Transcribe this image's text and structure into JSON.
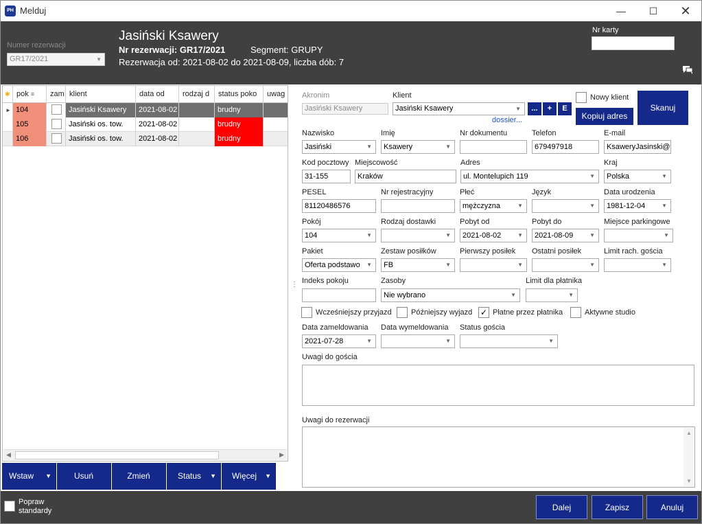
{
  "window": {
    "title": "Melduj",
    "app_icon_text": "PH"
  },
  "header": {
    "reservation_number_label": "Numer rezerwacji",
    "reservation_number_value": "GR17/2021",
    "guest_name": "Jasiński Ksawery",
    "reservation_nr": "Nr rezerwacji: GR17/2021",
    "segment": "Segment: GRUPY",
    "reservation_range": "Rezerwacja od: 2021-08-02 do 2021-08-09, liczba dób: 7",
    "card_label": "Nr karty",
    "card_value": ""
  },
  "grid": {
    "columns": [
      "pok",
      "zam",
      "klient",
      "data od",
      "rodzaj d",
      "status poko",
      "uwag"
    ],
    "rows": [
      {
        "room": "104",
        "client": "Jasiński Ksawery",
        "date_from": "2021-08-02",
        "meal": "",
        "status": "brudny",
        "notes": ""
      },
      {
        "room": "105",
        "client": "Jasiński os. tow.",
        "date_from": "2021-08-02",
        "meal": "",
        "status": "brudny",
        "notes": ""
      },
      {
        "room": "106",
        "client": "Jasiński os. tow.",
        "date_from": "2021-08-02",
        "meal": "",
        "status": "brudny",
        "notes": ""
      }
    ]
  },
  "actions": {
    "insert": "Wstaw",
    "delete": "Usuń",
    "change": "Zmień",
    "status": "Status",
    "more": "Więcej"
  },
  "form": {
    "akronim": {
      "label": "Akronim",
      "value": "Jasiński Ksawery"
    },
    "klient": {
      "label": "Klient",
      "value": "Jasiński Ksawery"
    },
    "btn_dots": "...",
    "btn_plus": "+",
    "btn_e": "E",
    "dossier": "dossier...",
    "nowy_klient": "Nowy klient",
    "kopiuj_adres": "Kopiuj adres",
    "skanuj": "Skanuj",
    "nazwisko": {
      "label": "Nazwisko",
      "value": "Jasiński"
    },
    "imie": {
      "label": "Imię",
      "value": "Ksawery"
    },
    "nr_dokumentu": {
      "label": "Nr dokumentu",
      "value": ""
    },
    "telefon": {
      "label": "Telefon",
      "value": "679497918"
    },
    "email": {
      "label": "E-mail",
      "value": "KsaweryJasinski@t"
    },
    "kod_pocztowy": {
      "label": "Kod pocztowy",
      "value": "31-155"
    },
    "miejscowosc": {
      "label": "Miejscowość",
      "value": "Kraków"
    },
    "adres": {
      "label": "Adres",
      "value": "ul. Montelupich 119"
    },
    "kraj": {
      "label": "Kraj",
      "value": "Polska"
    },
    "pesel": {
      "label": "PESEL",
      "value": "81120486576"
    },
    "nr_rejestracyjny": {
      "label": "Nr rejestracyjny",
      "value": ""
    },
    "plec": {
      "label": "Płeć",
      "value": "mężczyzna"
    },
    "jezyk": {
      "label": "Język",
      "value": ""
    },
    "data_urodzenia": {
      "label": "Data urodzenia",
      "value": "1981-12-04"
    },
    "pokoj": {
      "label": "Pokój",
      "value": "104"
    },
    "rodzaj_dostawki": {
      "label": "Rodzaj dostawki",
      "value": ""
    },
    "pobyt_od": {
      "label": "Pobyt od",
      "value": "2021-08-02"
    },
    "pobyt_do": {
      "label": "Pobyt do",
      "value": "2021-08-09"
    },
    "miejsce_parkingowe": {
      "label": "Miejsce parkingowe",
      "value": ""
    },
    "pakiet": {
      "label": "Pakiet",
      "value": "Oferta podstawo"
    },
    "zestaw_posilkow": {
      "label": "Zestaw posiłków",
      "value": "FB"
    },
    "pierwszy_posilek": {
      "label": "Pierwszy posiłek",
      "value": ""
    },
    "ostatni_posilek": {
      "label": "Ostatni posiłek",
      "value": ""
    },
    "limit_rach": {
      "label": "Limit rach. gościa",
      "value": ""
    },
    "indeks_pokoju": {
      "label": "Indeks pokoju",
      "value": ""
    },
    "zasoby": {
      "label": "Zasoby",
      "value": "Nie wybrano"
    },
    "limit_platnika": {
      "label": "Limit dla płatnika",
      "value": ""
    },
    "wczesniejszy_przyjazd": "Wcześniejszy przyjazd",
    "pozniejszy_wyjazd": "Późniejszy wyjazd",
    "platne_przez_platnika": "Płatne przez płatnika",
    "aktywne_studio": "Aktywne studio",
    "check_mark": "✓",
    "data_zameldowania": {
      "label": "Data zameldowania",
      "value": "2021-07-28"
    },
    "data_wymeldowania": {
      "label": "Data wymeldowania",
      "value": ""
    },
    "status_goscia": {
      "label": "Status gościa",
      "value": ""
    },
    "uwagi_goscia": "Uwagi do gościa",
    "uwagi_rezerwacji": "Uwagi do rezerwacji"
  },
  "footer": {
    "popraw_standardy": "Popraw standardy",
    "next": "Dalej",
    "save": "Zapisz",
    "cancel": "Anuluj"
  },
  "colors": {
    "header_bg": "#404040",
    "button_blue": "#14298a",
    "room_cell": "#f0907a",
    "status_dirty": "#ff0000",
    "selected_row": "#6e6e6e"
  }
}
